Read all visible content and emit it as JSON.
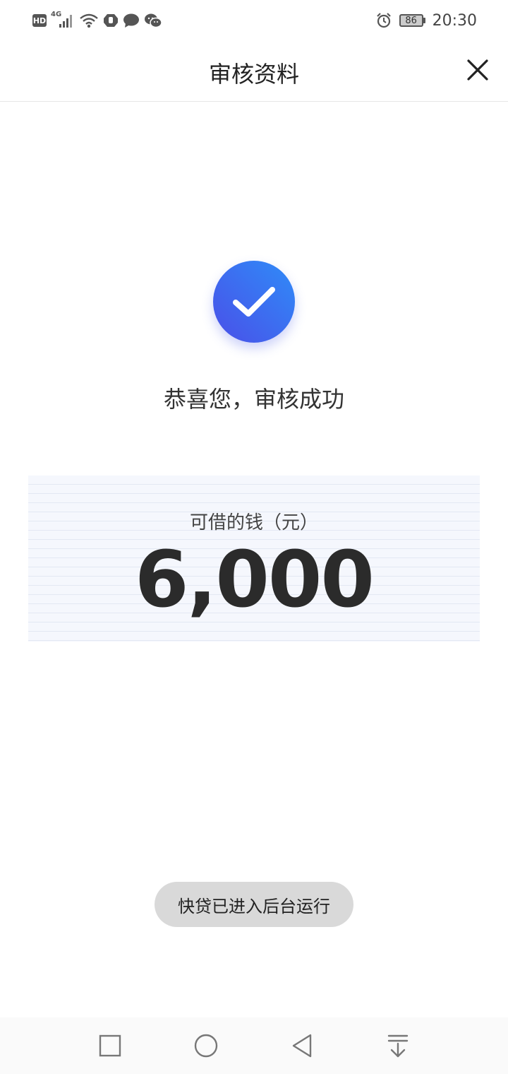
{
  "status_bar": {
    "hd_badge": "HD",
    "network_type": "4G",
    "battery_level": "86",
    "time": "20:30",
    "icons": [
      "hd-icon",
      "signal-icon",
      "wifi-icon",
      "shield-icon",
      "message-icon",
      "wechat-icon",
      "alarm-icon",
      "battery-icon"
    ]
  },
  "header": {
    "title": "审核资料",
    "close_icon": "close-icon"
  },
  "result": {
    "icon": "checkmark-icon",
    "message": "恭喜您，审核成功"
  },
  "amount": {
    "label": "可借的钱（元）",
    "value": "6,000"
  },
  "toast": {
    "text": "快贷已进入后台运行"
  },
  "nav_bar": {
    "icons": [
      "recent-apps-icon",
      "home-icon",
      "back-icon",
      "notification-shade-icon"
    ]
  },
  "colors": {
    "accent_start": "#2f8cf8",
    "accent_end": "#4a4fe8",
    "panel_bg": "#f5f7fd",
    "toast_bg": "#d9d9d9"
  }
}
